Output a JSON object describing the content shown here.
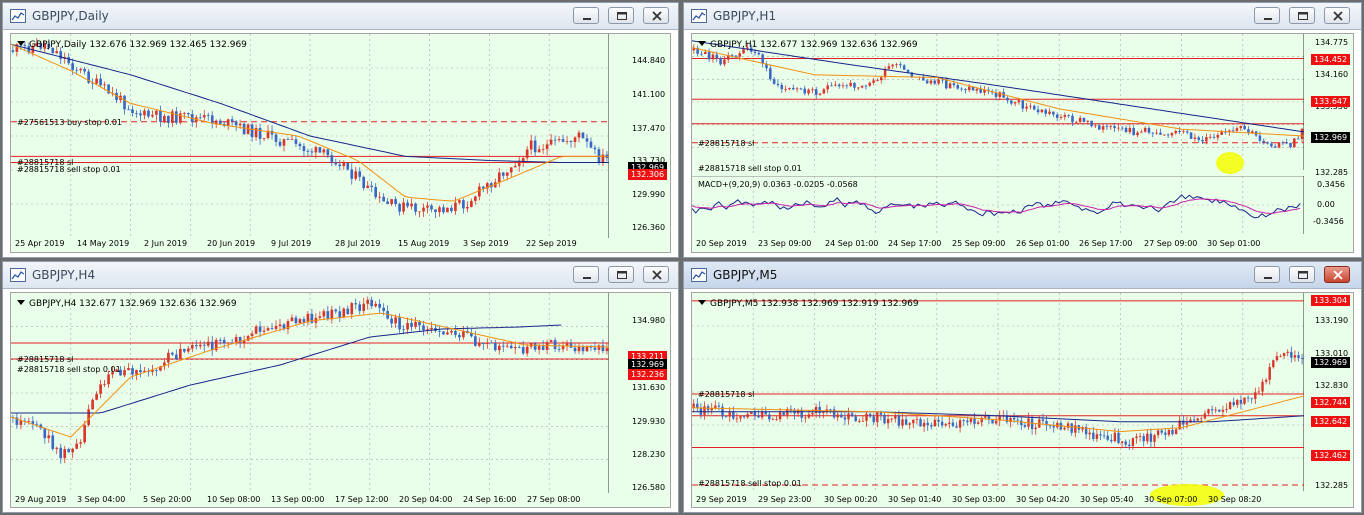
{
  "colors": {
    "up": "#d9362b",
    "down": "#3a66c4",
    "ma_fast": "#f2900f",
    "ma_slow": "#18258c",
    "level_line": "#e22222",
    "grid": "#a7a7a7",
    "macd_main": "#18258c",
    "macd_signal": "#cc22aa"
  },
  "windows": [
    {
      "id": "daily",
      "title": "GBPJPY,Daily",
      "header": "GBPJPY,Daily  132.676 132.969 132.465 132.969",
      "order_labels": [
        "#27561513 buy stop 0.01",
        "#28815718 sl",
        "#28815718 sell stop 0.01"
      ],
      "price_labels": [
        "144.840",
        "141.100",
        "137.470",
        "133.730",
        "129.990",
        "126.360"
      ],
      "price_tags": [
        {
          "text": "132.969",
          "kind": "current"
        },
        {
          "text": "132.306",
          "kind": "level"
        }
      ],
      "time_labels": [
        "25 Apr 2019",
        "14 May 2019",
        "2 Jun 2019",
        "20 Jun 2019",
        "9 Jul 2019",
        "28 Jul 2019",
        "15 Aug 2019",
        "3 Sep 2019",
        "22 Sep 2019"
      ]
    },
    {
      "id": "h1",
      "title": "GBPJPY,H1",
      "header": "GBPJPY,H1  132.677 132.969 132.636 132.969",
      "order_labels": [
        "#28815718 sl",
        "#28815718 sell stop 0.01"
      ],
      "price_labels": [
        "134.775",
        "134.160",
        "133.530",
        "132.285"
      ],
      "price_tags": [
        {
          "text": "134.452",
          "kind": "level"
        },
        {
          "text": "133.647",
          "kind": "level"
        },
        {
          "text": "132.969",
          "kind": "current"
        }
      ],
      "macd_header": "MACD+(9,20,9) 0.0363 -0.0205 -0.0568",
      "macd_labels": [
        "0.3456",
        "0.00",
        "-0.3456"
      ],
      "time_labels": [
        "20 Sep 2019",
        "23 Sep 09:00",
        "24 Sep 01:00",
        "24 Sep 17:00",
        "25 Sep 09:00",
        "26 Sep 01:00",
        "26 Sep 17:00",
        "27 Sep 09:00",
        "30 Sep 01:00"
      ]
    },
    {
      "id": "h4",
      "title": "GBPJPY,H4",
      "header": "GBPJPY,H4  132.677 132.969 132.636 132.969",
      "order_labels": [
        "#28815718 sl",
        "#28815718 sell stop 0.01"
      ],
      "price_labels": [
        "134.980",
        "131.630",
        "129.930",
        "128.230",
        "126.580"
      ],
      "price_tags": [
        {
          "text": "133.211",
          "kind": "level"
        },
        {
          "text": "132.969",
          "kind": "current"
        },
        {
          "text": "132.236",
          "kind": "level"
        }
      ],
      "time_labels": [
        "29 Aug 2019",
        "3 Sep 04:00",
        "5 Sep 20:00",
        "10 Sep 08:00",
        "13 Sep 00:00",
        "17 Sep 12:00",
        "20 Sep 04:00",
        "24 Sep 16:00",
        "27 Sep 08:00"
      ]
    },
    {
      "id": "m5",
      "title": "GBPJPY,M5",
      "header": "GBPJPY,M5  132.938 132.969 132.919 132.969",
      "order_labels": [
        "#28815718 sl",
        "#28815718 sell stop 0.01"
      ],
      "price_labels": [
        "133.190",
        "133.010",
        "132.830",
        "132.285"
      ],
      "price_tags": [
        {
          "text": "133.304",
          "kind": "level"
        },
        {
          "text": "132.969",
          "kind": "current"
        },
        {
          "text": "132.744",
          "kind": "level"
        },
        {
          "text": "132.642",
          "kind": "level"
        },
        {
          "text": "132.462",
          "kind": "level"
        }
      ],
      "time_labels": [
        "29 Sep 2019",
        "29 Sep 23:00",
        "30 Sep 00:20",
        "30 Sep 01:40",
        "30 Sep 03:00",
        "30 Sep 04:20",
        "30 Sep 05:40",
        "30 Sep 07:00",
        "30 Sep 08:20"
      ]
    }
  ]
}
